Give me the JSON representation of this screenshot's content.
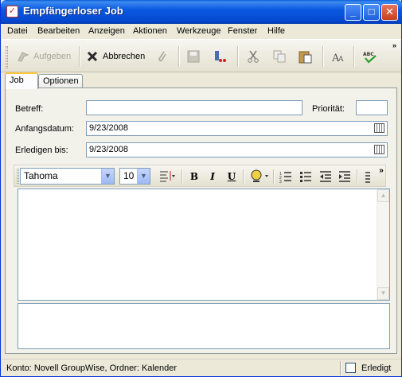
{
  "window": {
    "title": "Empfängerloser Job",
    "minimize_glyph": "_",
    "maximize_glyph": "□",
    "close_glyph": "✕",
    "title_icon_glyph": "✓"
  },
  "menu": [
    {
      "label": "Datei"
    },
    {
      "label": "Bearbeiten"
    },
    {
      "label": "Anzeigen"
    },
    {
      "label": "Aktionen"
    },
    {
      "label": "Werkzeuge"
    },
    {
      "label": "Fenster"
    },
    {
      "label": "Hilfe"
    }
  ],
  "toolbar": {
    "send_label": "Aufgeben",
    "cancel_label": "Abbrechen",
    "overflow_glyph": "»"
  },
  "tabs": [
    {
      "label": "Job"
    },
    {
      "label": "Optionen"
    }
  ],
  "form": {
    "subject_label": "Betreff:",
    "subject_value": "",
    "priority_label": "Priorität:",
    "priority_value": "",
    "start_label": "Anfangsdatum:",
    "start_value": "9/23/2008",
    "due_label": "Erledigen bis:",
    "due_value": "9/23/2008"
  },
  "format": {
    "font": "Tahoma",
    "size": "10",
    "bold": "B",
    "italic": "I",
    "underline": "U",
    "overflow_glyph": "»"
  },
  "status": {
    "text": "Konto: Novell GroupWise,  Ordner: Kalender",
    "done_label": "Erledigt",
    "done_checked": false
  }
}
